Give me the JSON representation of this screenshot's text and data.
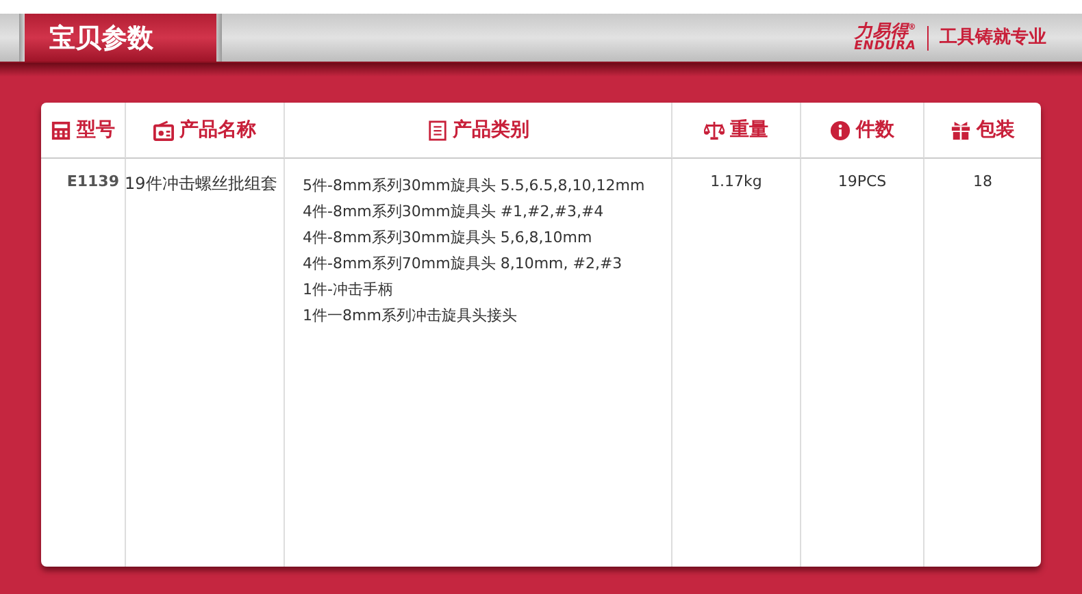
{
  "header": {
    "title": "宝贝参数",
    "brand": "力易得$^{®}$",
    "brand_latin": "ENDURA",
    "slogan": "工具铸就专业"
  },
  "table": {
    "columns": [
      {
        "label": "型号",
        "kind": "calc"
      },
      {
        "label": "产品名称",
        "kind": "radio"
      },
      {
        "label": "产品类别",
        "kind": "doc"
      },
      {
        "label": "重量",
        "kind": "scale"
      },
      {
        "label": "件数",
        "kind": "info"
      },
      {
        "label": "包装",
        "kind": "gift"
      }
    ],
    "rows": [
      {
        "model": "E1139",
        "name": "19件冲击螺丝批组套",
        "category": [
          "5件-8mm系列30mm旋具头 5.5,6.5,8,10,12mm",
          "4件-8mm系列30mm旋具头 #1,#2,#3,#4",
          "4件-8mm系列30mm旋具头 5,6,8,10mm",
          "4件-8mm系列70mm旋具头 8,10mm, #2,#3",
          "1件-冲击手柄",
          "1件一8mm系列冲击旋具头接头"
        ],
        "weight": "1.17kg",
        "count": "19PCS",
        "package": "18"
      }
    ]
  }
}
